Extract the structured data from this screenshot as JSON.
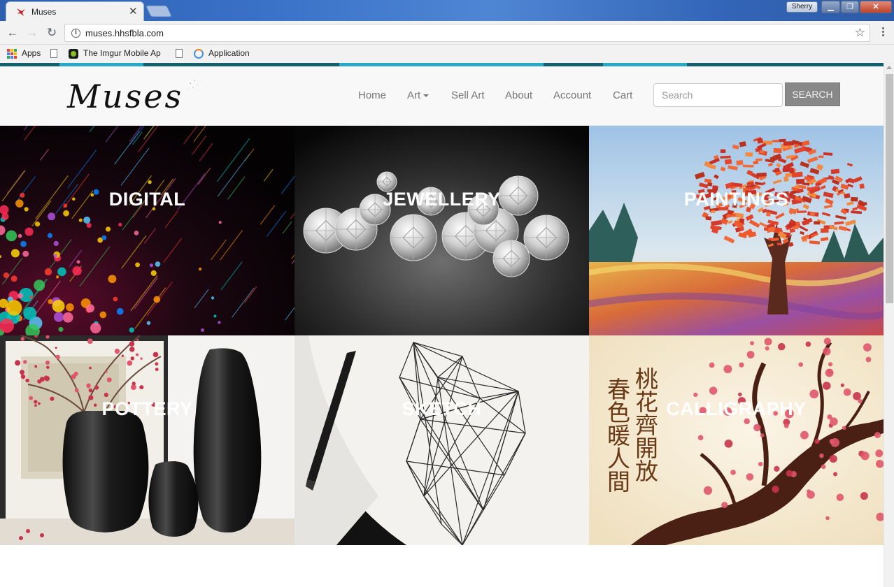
{
  "browser": {
    "tab_title": "Muses",
    "url": "muses.hhsfbla.com",
    "profile_name": "Sherry",
    "bookmarks": [
      {
        "label": "Apps",
        "icon": "apps-grid-icon"
      },
      {
        "label": "",
        "icon": "document-icon"
      },
      {
        "label": "The Imgur Mobile Ap",
        "icon": "imgur-icon"
      },
      {
        "label": "",
        "icon": "document-icon"
      },
      {
        "label": "Application",
        "icon": "application-icon"
      }
    ]
  },
  "site": {
    "logo": "Muses",
    "nav": {
      "home": "Home",
      "art": "Art",
      "sell_art": "Sell Art",
      "about": "About",
      "account": "Account",
      "cart": "Cart"
    },
    "search": {
      "placeholder": "Search",
      "button": "SEARCH"
    },
    "accent_colors": [
      "#1a7a8c",
      "#2aa8c8",
      "#15606e"
    ]
  },
  "categories": [
    {
      "label": "DIGITAL",
      "image": "colorful-particles"
    },
    {
      "label": "JEWELLERY",
      "image": "diamonds"
    },
    {
      "label": "PAINTINGS",
      "image": "autumn-tree"
    },
    {
      "label": "POTTERY",
      "image": "black-vases"
    },
    {
      "label": "SKETCH",
      "image": "geometric-eagle"
    },
    {
      "label": "CALLIGRAPHY",
      "image": "plum-blossom",
      "calligraphy_text": [
        "桃花齊開放",
        "春色暖人間"
      ]
    }
  ]
}
